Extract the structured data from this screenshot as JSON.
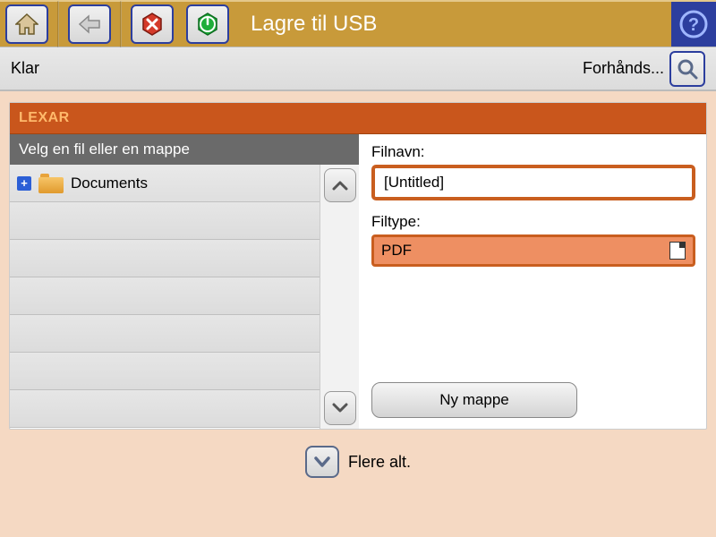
{
  "header": {
    "title": "Lagre til USB"
  },
  "status": {
    "text": "Klar",
    "preview_label": "Forhånds..."
  },
  "panel": {
    "device_label": "LEXAR",
    "sub_header": "Velg en fil eller en mappe"
  },
  "files": {
    "items": [
      {
        "name": "Documents",
        "type": "folder",
        "expandable": true
      }
    ]
  },
  "form": {
    "filename_label": "Filnavn:",
    "filename_value": "[Untitled]",
    "filetype_label": "Filtype:",
    "filetype_value": "PDF",
    "new_folder_label": "Ny mappe"
  },
  "more": {
    "label": "Flere alt."
  },
  "icons": {
    "home": "home-icon",
    "back": "back-arrow-icon",
    "cancel": "cancel-icon",
    "start": "start-icon",
    "help": "help-icon",
    "magnify": "magnify-icon",
    "up": "chevron-up-icon",
    "down": "chevron-down-icon"
  }
}
